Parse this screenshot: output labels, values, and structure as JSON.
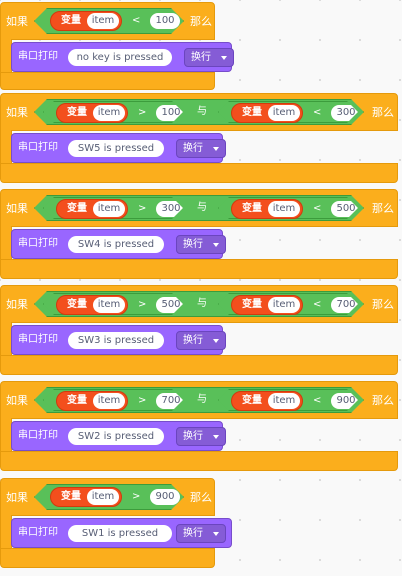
{
  "keywords": {
    "if": "如果",
    "then": "那么",
    "and": "与",
    "var": "变量",
    "print": "串口打印",
    "newline": "换行"
  },
  "item_name": "item",
  "blocks": [
    {
      "conditions": [
        {
          "op": "<",
          "value": "100"
        }
      ],
      "message": "no key is pressed"
    },
    {
      "conditions": [
        {
          "op": ">",
          "value": "100"
        },
        {
          "op": "<",
          "value": "300"
        }
      ],
      "message": "SW5 is pressed"
    },
    {
      "conditions": [
        {
          "op": ">",
          "value": "300"
        },
        {
          "op": "<",
          "value": "500"
        }
      ],
      "message": "SW4 is pressed"
    },
    {
      "conditions": [
        {
          "op": ">",
          "value": "500"
        },
        {
          "op": "<",
          "value": "700"
        }
      ],
      "message": "SW3 is pressed"
    },
    {
      "conditions": [
        {
          "op": ">",
          "value": "700"
        },
        {
          "op": "<",
          "value": "900"
        }
      ],
      "message": "SW2 is pressed"
    },
    {
      "conditions": [
        {
          "op": ">",
          "value": "900"
        }
      ],
      "message": "SW1 is pressed"
    }
  ],
  "colors": {
    "control": "#fbae1c",
    "operator": "#59c059",
    "variable": "#f34f1d",
    "serial": "#9966ff"
  }
}
